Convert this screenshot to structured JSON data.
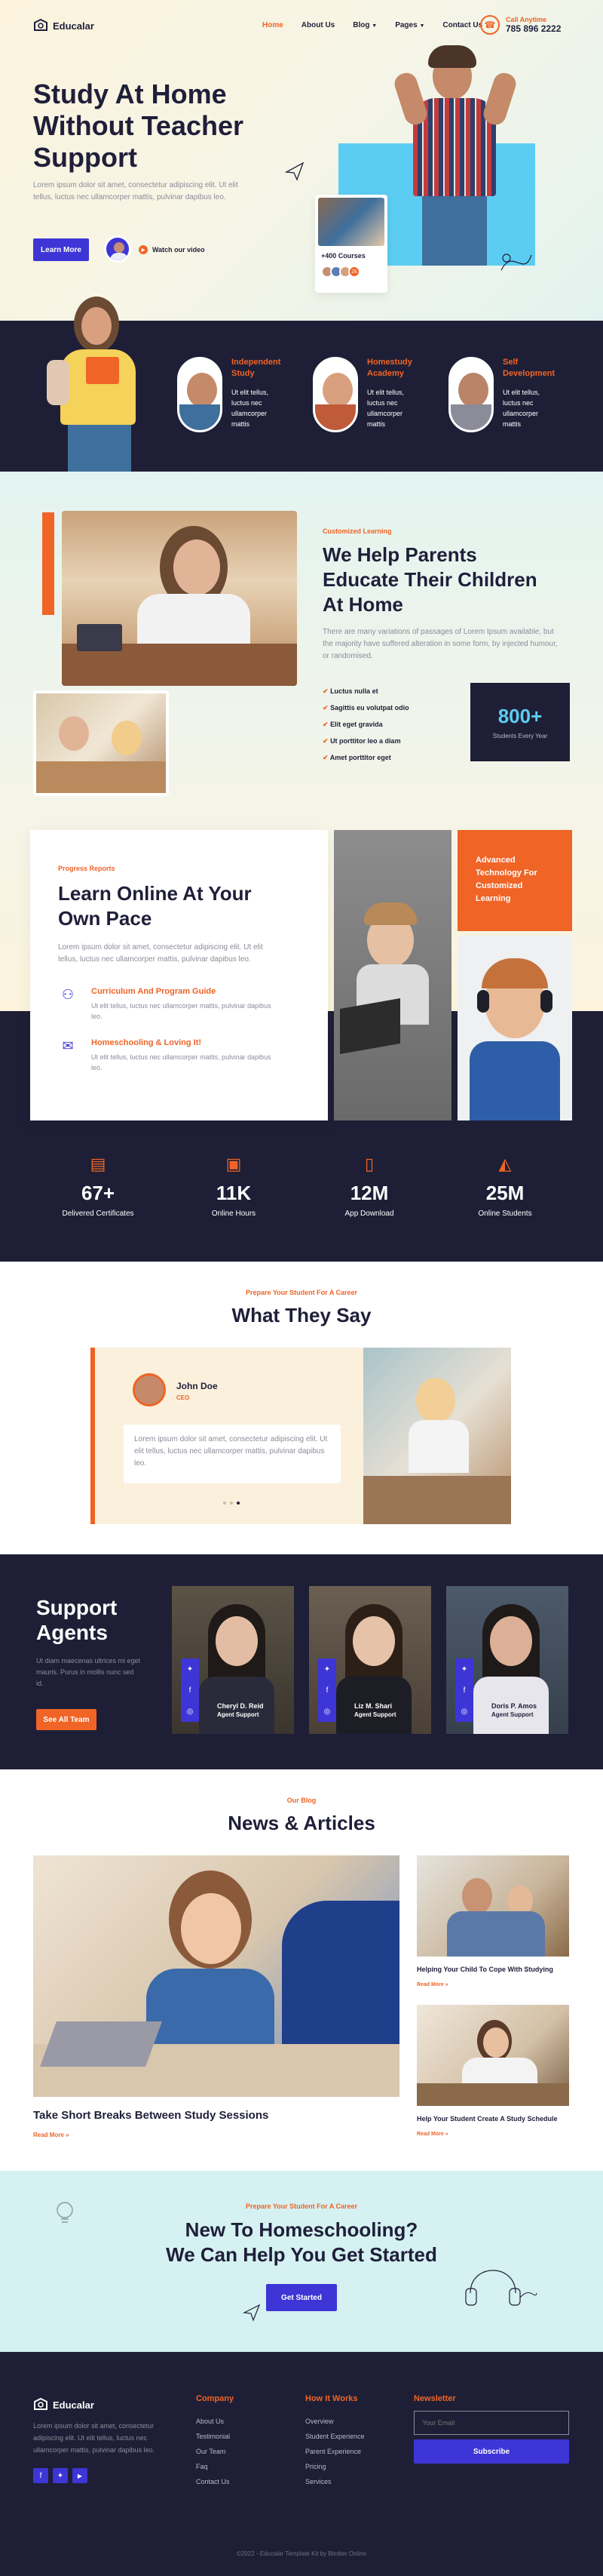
{
  "brand": {
    "name": "Educalar"
  },
  "nav": {
    "items": [
      "Home",
      "About Us",
      "Blog",
      "Pages",
      "Contact Us"
    ],
    "active": 0
  },
  "contact": {
    "label": "Call Anytime",
    "phone": "785 896 2222"
  },
  "hero": {
    "title_lines": [
      "Study At Home",
      "Without Teacher",
      "Support"
    ],
    "desc": "Lorem ipsum dolor sit amet, consectetur adipiscing elit. Ut elit tellus, luctus nec ullamcorper mattis, pulvinar dapibus leo.",
    "btn": "Learn More",
    "video": "Watch our video",
    "courses": "+400 Courses",
    "avatar_more": "2k"
  },
  "features": [
    {
      "title": "Independent Study",
      "desc": "Ut elit tellus, luctus nec ullamcorper mattis"
    },
    {
      "title": "Homestudy Academy",
      "desc": "Ut elit tellus, luctus nec ullamcorper mattis"
    },
    {
      "title": "Self Development",
      "desc": "Ut elit tellus, luctus nec ullamcorper mattis"
    }
  ],
  "about": {
    "tag": "Customized Learning",
    "title_lines": [
      "We Help Parents",
      "Educate Their Children",
      "At Home"
    ],
    "desc": "There are many variations of passages of Lorem Ipsum available, but the majority have suffered alteration in some form, by injected humour, or randomised.",
    "list": [
      "Luctus nulla et",
      "Sagittis eu volutpat odio",
      "Elit eget gravida",
      "Ut porttitor leo a diam",
      "Amet porttitor eget"
    ],
    "stat_value": "800+",
    "stat_label": "Students Every Year"
  },
  "learn": {
    "tag": "Progress Reports",
    "title_lines": [
      "Learn Online At Your",
      "Own Pace"
    ],
    "desc": "Lorem ipsum dolor sit amet, consectetur adipiscing elit. Ut elit tellus, luctus nec ullamcorper mattis, pulvinar dapibus leo.",
    "items": [
      {
        "title": "Curriculum And Program Guide",
        "desc": "Ut elit tellus, luctus nec ullamcorper mattis, pulvinar dapibus leo."
      },
      {
        "title": "Homeschooling & Loving It!",
        "desc": "Ut elit tellus, luctus nec ullamcorper mattis, pulvinar dapibus leo."
      }
    ],
    "badge_lines": [
      "Advanced",
      "Technology For",
      "Customized",
      "Learning"
    ]
  },
  "stats": [
    {
      "value": "67+",
      "label": "Delivered Certificates"
    },
    {
      "value": "11K",
      "label": "Online Hours"
    },
    {
      "value": "12M",
      "label": "App Download"
    },
    {
      "value": "25M",
      "label": "Online Students"
    }
  ],
  "testimonial": {
    "tag": "Prepare Your Student For A Career",
    "title": "What They Say",
    "name": "John Doe",
    "role": "CEO",
    "quote": "Lorem ipsum dolor sit amet, consectetur adipiscing elit. Ut elit tellus, luctus nec ullamcorper mattis, pulvinar dapibus leo."
  },
  "agents": {
    "title_lines": [
      "Support",
      "Agents"
    ],
    "desc": "Ut diam maecenas ultrices mi eget mauris. Purus in mollis nunc sed id.",
    "btn": "See All Team",
    "people": [
      {
        "name": "Cheryl D. Reid",
        "role": "Agent Support"
      },
      {
        "name": "Liz M. Shari",
        "role": "Agent Support"
      },
      {
        "name": "Doris P. Amos",
        "role": "Agent Support"
      }
    ]
  },
  "blog": {
    "tag": "Our Blog",
    "title": "News & Articles",
    "main_title": "Take Short Breaks Between Study Sessions",
    "read_more": "Read More »",
    "side": [
      {
        "title": "Helping Your Child To Cope With Studying",
        "link": "Read More »"
      },
      {
        "title": "Help Your Student Create A Study Schedule",
        "link": "Read More »"
      }
    ]
  },
  "cta": {
    "tag": "Prepare Your Student For A Career",
    "title_lines": [
      "New To Homeschooling?",
      "We Can Help You Get Started"
    ],
    "btn": "Get Started"
  },
  "footer": {
    "desc": "Lorem ipsum dolor sit amet, consectetur adipiscing elit. Ut elit tellus, luctus nec ullamcorper mattis, pulvinar dapibus leo.",
    "company": {
      "title": "Company",
      "links": [
        "About Us",
        "Testimonial",
        "Our Team",
        "Faq",
        "Contact Us"
      ]
    },
    "how": {
      "title": "How It Works",
      "links": [
        "Overview",
        "Student Experience",
        "Parent Experience",
        "Pricing",
        "Services"
      ]
    },
    "newsletter": {
      "title": "Newsletter",
      "placeholder": "Your Email",
      "btn": "Subscribe"
    },
    "copyright": "©2022 - Educalar Template Kit by Bimber Online"
  },
  "colors": {
    "accent": "#f06426",
    "primary": "#3d35d6",
    "navy": "#1e1f36",
    "cyan": "#5ccdf2"
  }
}
